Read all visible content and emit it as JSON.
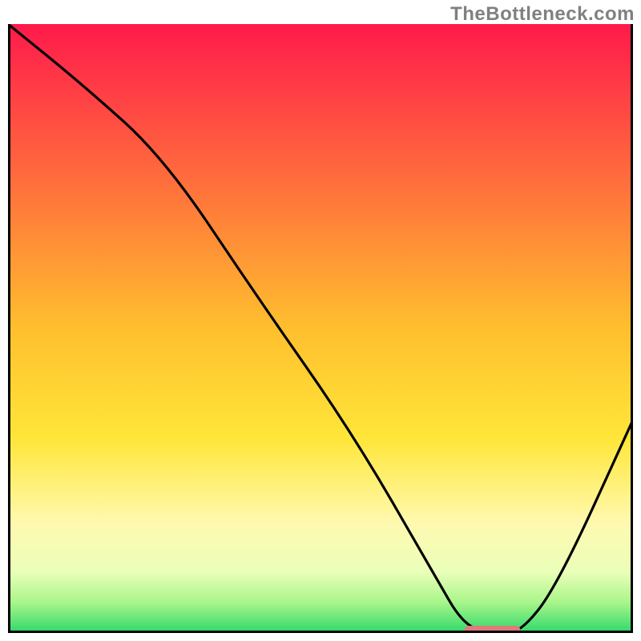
{
  "attribution": "TheBottleneck.com",
  "chart_data": {
    "type": "line",
    "title": "",
    "xlabel": "",
    "ylabel": "",
    "xlim": [
      0,
      100
    ],
    "ylim": [
      0,
      100
    ],
    "legend": null,
    "grid": false,
    "series": [
      {
        "name": "bottleneck-curve",
        "x": [
          0,
          12,
          25,
          40,
          55,
          68,
          73,
          78,
          82,
          88,
          100
        ],
        "y": [
          100,
          90,
          78,
          55,
          33,
          10,
          1,
          0,
          0,
          8,
          35
        ]
      }
    ],
    "optimal_marker": {
      "x_start": 73,
      "x_end": 82,
      "y": 0,
      "color": "#e07a7a"
    },
    "gradient_stops": [
      {
        "offset": 0,
        "color": "#ff1a4b"
      },
      {
        "offset": 0.25,
        "color": "#ff6b3d"
      },
      {
        "offset": 0.5,
        "color": "#ffbf2e"
      },
      {
        "offset": 0.68,
        "color": "#ffe639"
      },
      {
        "offset": 0.82,
        "color": "#fff9b0"
      },
      {
        "offset": 0.9,
        "color": "#eaffb8"
      },
      {
        "offset": 0.95,
        "color": "#a8f58a"
      },
      {
        "offset": 1.0,
        "color": "#2fd86a"
      }
    ]
  }
}
